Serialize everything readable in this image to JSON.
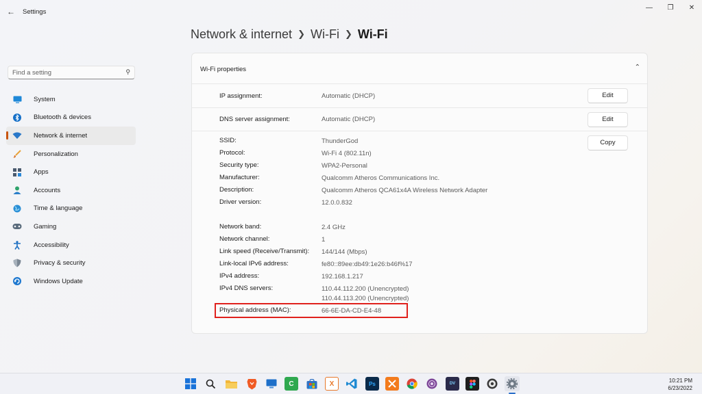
{
  "app": {
    "title": "Settings"
  },
  "window_controls": {
    "minimize": "—",
    "maximize": "❐",
    "close": "✕"
  },
  "search": {
    "placeholder": "Find a setting"
  },
  "sidebar": {
    "items": [
      {
        "label": "System",
        "icon": "monitor-icon"
      },
      {
        "label": "Bluetooth & devices",
        "icon": "bluetooth-icon"
      },
      {
        "label": "Network & internet",
        "icon": "wifi-icon",
        "active": true
      },
      {
        "label": "Personalization",
        "icon": "brush-icon"
      },
      {
        "label": "Apps",
        "icon": "apps-icon"
      },
      {
        "label": "Accounts",
        "icon": "person-icon"
      },
      {
        "label": "Time & language",
        "icon": "globe-icon"
      },
      {
        "label": "Gaming",
        "icon": "gamepad-icon"
      },
      {
        "label": "Accessibility",
        "icon": "accessibility-icon"
      },
      {
        "label": "Privacy & security",
        "icon": "shield-icon"
      },
      {
        "label": "Windows Update",
        "icon": "update-icon"
      }
    ]
  },
  "breadcrumb": [
    "Network & internet",
    "Wi-Fi",
    "Wi-Fi"
  ],
  "panel": {
    "title": "Wi-Fi properties",
    "ip_assignment": {
      "label": "IP assignment:",
      "value": "Automatic (DHCP)",
      "button": "Edit"
    },
    "dns_assignment": {
      "label": "DNS server assignment:",
      "value": "Automatic (DHCP)",
      "button": "Edit"
    },
    "copy_button": "Copy",
    "properties": [
      {
        "label": "SSID:",
        "value": "ThunderGod"
      },
      {
        "label": "Protocol:",
        "value": "Wi-Fi 4 (802.11n)"
      },
      {
        "label": "Security type:",
        "value": "WPA2-Personal"
      },
      {
        "label": "Manufacturer:",
        "value": "Qualcomm Atheros Communications Inc."
      },
      {
        "label": "Description:",
        "value": "Qualcomm Atheros QCA61x4A Wireless Network Adapter"
      },
      {
        "label": "Driver version:",
        "value": "12.0.0.832"
      },
      {
        "label": "Network band:",
        "value": "2.4 GHz"
      },
      {
        "label": "Network channel:",
        "value": "1"
      },
      {
        "label": "Link speed (Receive/Transmit):",
        "value": "144/144 (Mbps)"
      },
      {
        "label": "Link-local IPv6 address:",
        "value": "fe80::89ee:db49:1e26:b46f%17"
      },
      {
        "label": "IPv4 address:",
        "value": "192.168.1.217"
      },
      {
        "label": "IPv4 DNS servers:",
        "value": "110.44.112.200 (Unencrypted)",
        "value2": "110.44.113.200 (Unencrypted)"
      },
      {
        "label": "Physical address (MAC):",
        "value": "66-6E-DA-CD-E4-48"
      }
    ]
  },
  "taskbar": {
    "icons": [
      {
        "name": "windows-start-icon",
        "color": "#1a73d9"
      },
      {
        "name": "search-icon",
        "color": "#333333"
      },
      {
        "name": "file-explorer-icon",
        "color": "#f2b63a"
      },
      {
        "name": "brave-browser-icon",
        "color": "#f05a24"
      },
      {
        "name": "remote-desktop-icon",
        "color": "#1e6fc9"
      },
      {
        "name": "excel-sheet-icon",
        "color": "#2e8b57"
      },
      {
        "name": "camtasia-icon",
        "color": "#5cb85c"
      },
      {
        "name": "store-icon",
        "color": "#2f72c4"
      },
      {
        "name": "xampp-icon",
        "color": "#e8782a"
      },
      {
        "name": "vscode-icon",
        "color": "#1f8ad2"
      },
      {
        "name": "photoshop-icon",
        "color": "#0a2a4a"
      },
      {
        "name": "xampp-control-icon",
        "color": "#f37b1d"
      },
      {
        "name": "chrome-icon",
        "color": "#e8b000"
      },
      {
        "name": "tor-browser-icon",
        "color": "#7d4698"
      },
      {
        "name": "davinci-icon",
        "color": "#2a2a4a"
      },
      {
        "name": "figma-icon",
        "color": "#1e1e1e"
      },
      {
        "name": "obs-icon",
        "color": "#444444"
      },
      {
        "name": "settings-icon",
        "color": "#6f7a86"
      }
    ],
    "time": "10:21 PM",
    "date": "6/23/2022"
  }
}
